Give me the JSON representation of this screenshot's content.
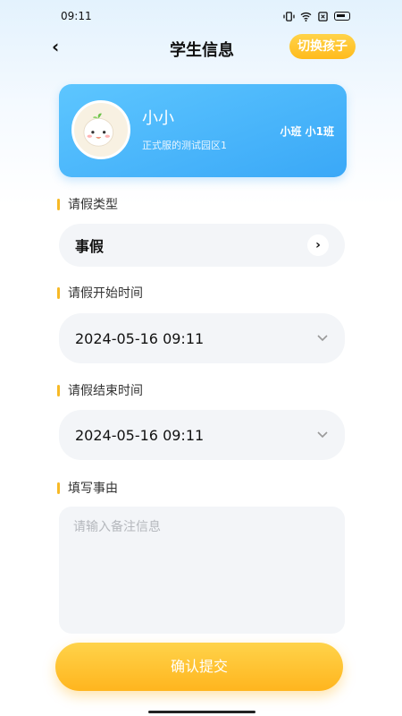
{
  "status_bar": {
    "time": "09:11"
  },
  "nav": {
    "title": "学生信息",
    "switch_label": "切换孩子",
    "back_icon": "chevron-left-icon"
  },
  "student": {
    "name": "小小",
    "school": "正式服的测试园区1",
    "class": "小班 小1班"
  },
  "leave_type": {
    "label": "请假类型",
    "value": "事假"
  },
  "start_time": {
    "label": "请假开始时间",
    "value": "2024-05-16 09:11"
  },
  "end_time": {
    "label": "请假结束时间",
    "value": "2024-05-16 09:11"
  },
  "reason": {
    "label": "填写事由",
    "placeholder": "请输入备注信息",
    "value": ""
  },
  "submit": {
    "label": "确认提交"
  },
  "colors": {
    "accent": "#ffbb1c",
    "card": "#3aa8f7"
  }
}
